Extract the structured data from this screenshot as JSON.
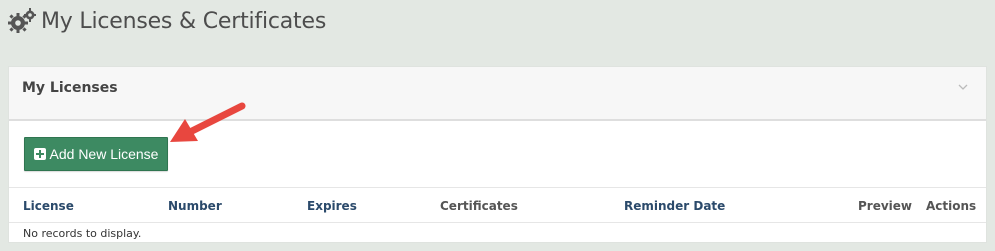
{
  "page": {
    "title": "My Licenses & Certificates",
    "title_icon": "gears-icon"
  },
  "panel": {
    "title": "My Licenses",
    "collapse_icon": "chevron-down-icon"
  },
  "actions": {
    "add_button_label": "Add New License",
    "add_button_icon": "plus-square-icon",
    "add_button_color": "#3d8a62"
  },
  "annotation": {
    "arrow_color": "#e8473f",
    "arrow_icon": "callout-arrow"
  },
  "table": {
    "columns": [
      "License",
      "Number",
      "Expires",
      "Certificates",
      "Reminder Date",
      "Preview",
      "Actions"
    ],
    "empty_message": "No records to display."
  }
}
